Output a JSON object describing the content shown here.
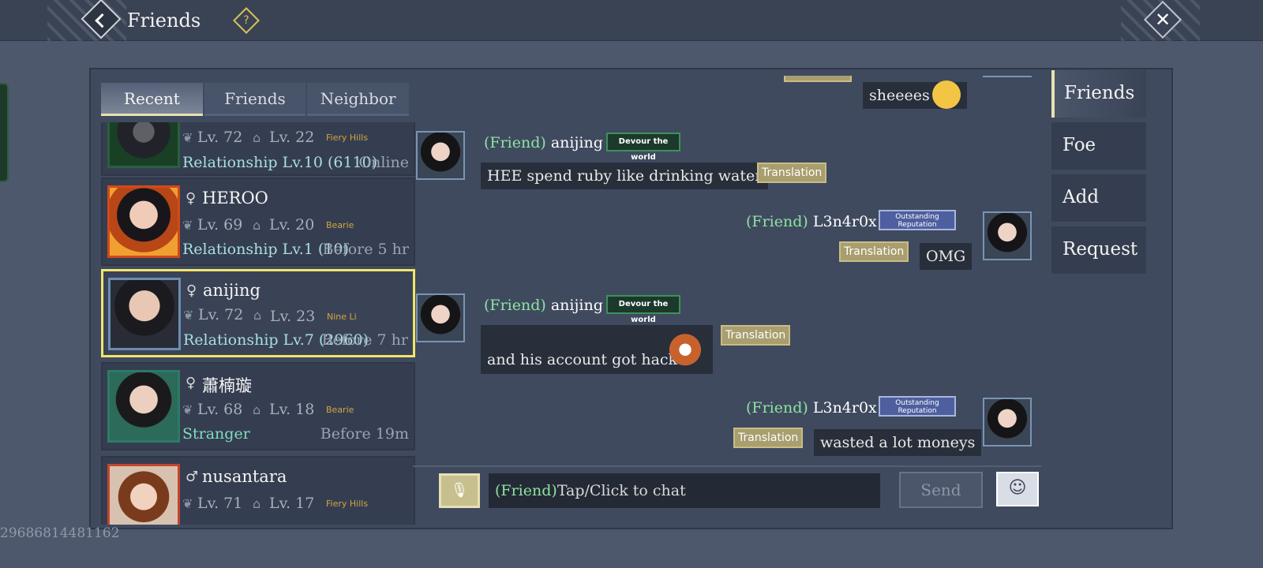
{
  "header": {
    "title": "Friends",
    "help_icon": "?",
    "close_icon": "✕"
  },
  "tabs": [
    "Recent",
    "Friends",
    "Neighbor"
  ],
  "friends": [
    {
      "name": "",
      "gender": "",
      "level": "Lv. 72",
      "house_level": "Lv. 22",
      "location": "Fiery Hills",
      "relationship": "Relationship Lv.10 (6110)",
      "status": "Online"
    },
    {
      "name": "HEROO",
      "gender": "♀",
      "level": "Lv. 69",
      "house_level": "Lv. 20",
      "location": "Bearie",
      "relationship": "Relationship Lv.1 (10)",
      "status": "Before 5 hr"
    },
    {
      "name": "anijing",
      "gender": "♀",
      "level": "Lv. 72",
      "house_level": "Lv. 23",
      "location": "Nine Li",
      "relationship": "Relationship Lv.7 (2960)",
      "status": "Before 7 hr"
    },
    {
      "name": "蕭楠璇",
      "gender": "♀",
      "level": "Lv. 68",
      "house_level": "Lv. 18",
      "location": "Bearie",
      "relationship": "Stranger",
      "status": "Before 19m"
    },
    {
      "name": "nusantara",
      "gender": "♂",
      "level": "Lv. 71",
      "house_level": "Lv. 17",
      "location": "Fiery Hills",
      "relationship": "",
      "status": ""
    }
  ],
  "chat": {
    "tag": "(Friend)",
    "translation_label": "Translation",
    "badge_devour": "Devour the world",
    "badge_reputation": "Outstanding Reputation",
    "messages": [
      {
        "sender": "",
        "text": "sheeees",
        "mine": true
      },
      {
        "sender": "anijing",
        "text": "HEE spend ruby like drinking water",
        "mine": false
      },
      {
        "sender": "L3n4r0x",
        "text": "OMG",
        "mine": true
      },
      {
        "sender": "anijing",
        "text": "and his account got hack",
        "mine": false
      },
      {
        "sender": "L3n4r0x",
        "text": "wasted a lot moneys",
        "mine": true
      }
    ],
    "input_placeholder": "Tap/Click to chat",
    "send_label": "Send"
  },
  "side_nav": [
    "Friends",
    "Foe",
    "Add",
    "Request"
  ],
  "uid": "29686814481162"
}
